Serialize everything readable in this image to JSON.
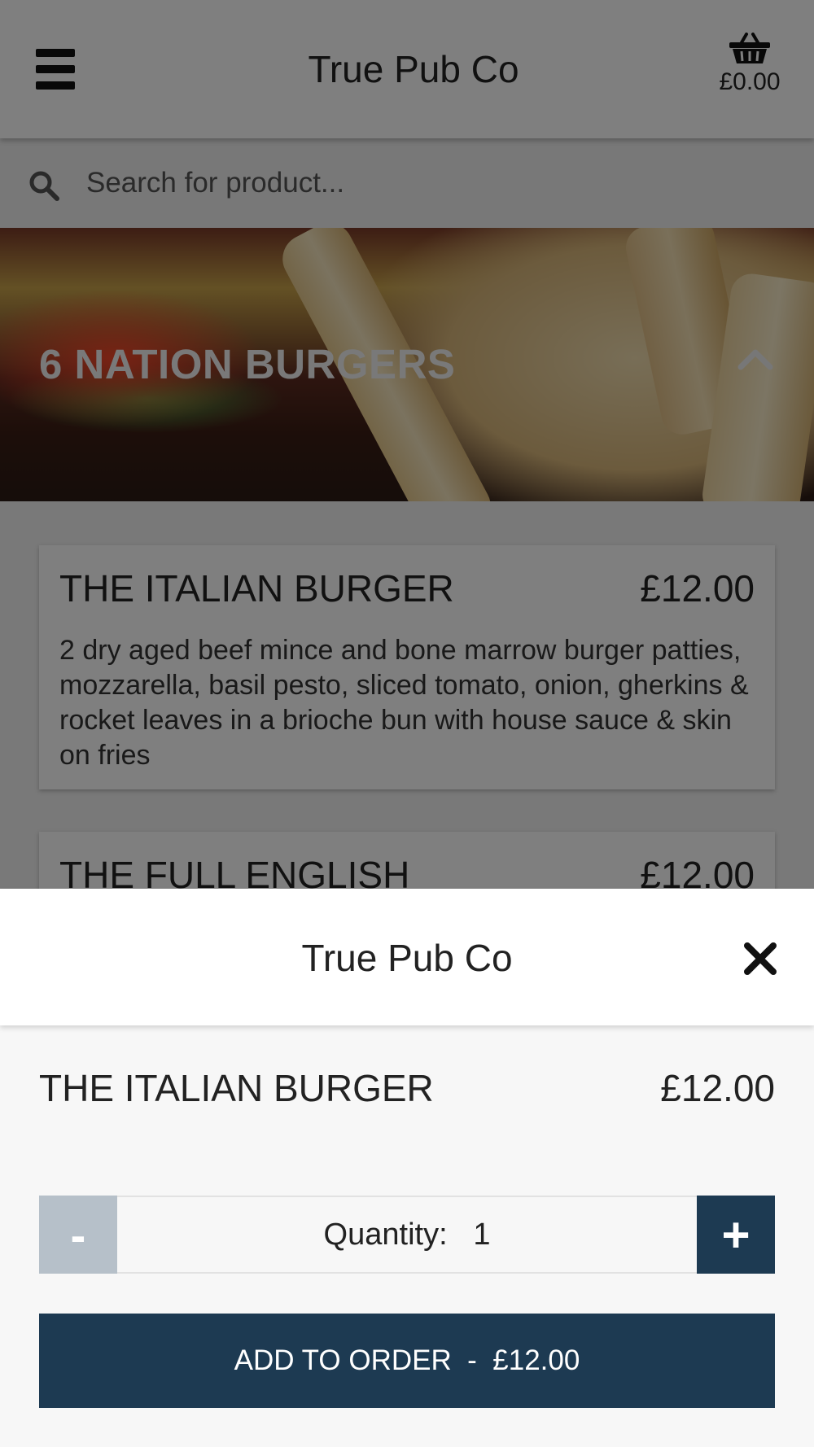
{
  "header": {
    "title": "True Pub Co",
    "menu_icon": "hamburger-menu-icon",
    "basket_icon": "basket-icon",
    "basket_total": "£0.00"
  },
  "search": {
    "placeholder": "Search for product...",
    "value": "",
    "icon": "search-icon"
  },
  "category": {
    "title": "6 NATION BURGERS",
    "toggle_icon": "chevron-up-icon"
  },
  "products": [
    {
      "name": "THE ITALIAN BURGER",
      "price": "£12.00",
      "description": "2 dry aged beef mince and bone marrow burger patties, mozzarella, basil pesto, sliced tomato, onion, gherkins & rocket leaves in a brioche bun with house sauce & skin on fries"
    },
    {
      "name": "THE FULL ENGLISH",
      "price": "£12.00"
    }
  ],
  "modal": {
    "title": "True Pub Co",
    "close_icon": "close-icon",
    "item_name": "THE ITALIAN BURGER",
    "item_price": "£12.00",
    "quantity_label": "Quantity:",
    "quantity_value": "1",
    "minus_label": "-",
    "plus_label": "+",
    "add_button_label": "ADD TO ORDER  -  £12.00"
  },
  "colors": {
    "accent": "#1d3a52",
    "minus_disabled": "#b6c0c9",
    "overlay": "rgba(0,0,0,0.5)"
  }
}
